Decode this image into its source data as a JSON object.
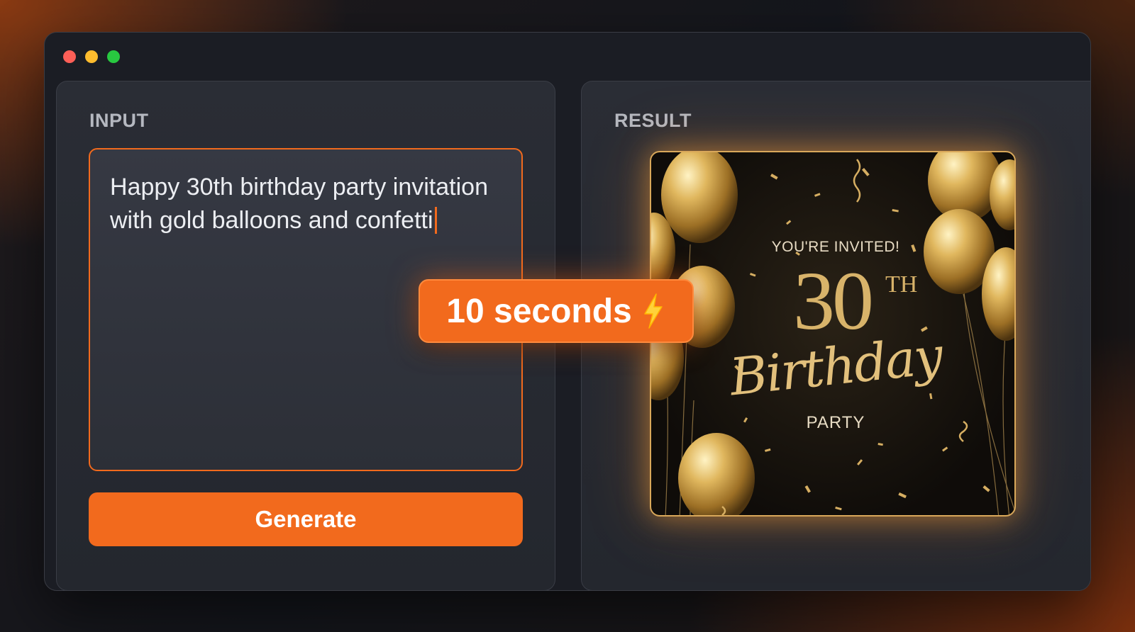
{
  "window": {
    "traffic_lights": [
      "close",
      "minimize",
      "maximize"
    ]
  },
  "input_panel": {
    "label": "INPUT",
    "prompt_text": "Happy 30th birthday party invitation with gold balloons and confetti",
    "generate_label": "Generate"
  },
  "result_panel": {
    "label": "RESULT",
    "invitation": {
      "headline": "YOU'RE INVITED!",
      "number": "30",
      "superscript": "TH",
      "script_text": "Birthday",
      "subtitle": "PARTY"
    }
  },
  "badge": {
    "text": "10 seconds",
    "icon": "lightning-bolt-icon"
  },
  "colors": {
    "accent": "#f26a1d",
    "gold": "#d8b36a",
    "panel_bg": "#2a2d35",
    "window_bg": "#1b1d24"
  }
}
